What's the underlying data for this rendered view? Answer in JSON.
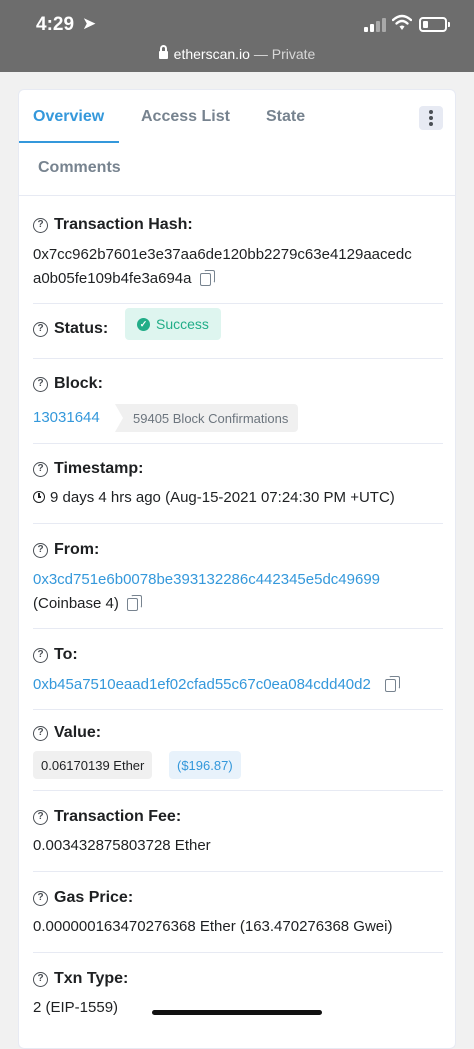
{
  "status_bar": {
    "time": "4:29",
    "domain": "etherscan.io",
    "separator": " — ",
    "private_label": "Private"
  },
  "tabs": [
    {
      "label": "Overview",
      "active": true
    },
    {
      "label": "Access List"
    },
    {
      "label": "State"
    },
    {
      "label": "Comments"
    }
  ],
  "more_icon": "vertical-dots-icon",
  "fields": {
    "tx_hash": {
      "label": "Transaction Hash:",
      "line1": "0x7cc962b7601e3e37aa6de120bb2279c63e4129aacedc",
      "line2": "a0b05fe109b4fe3a694a"
    },
    "status": {
      "label": "Status:",
      "value": "Success"
    },
    "block": {
      "label": "Block:",
      "number": "13031644",
      "confirmations": "59405 Block Confirmations"
    },
    "timestamp": {
      "label": "Timestamp:",
      "value": "9 days 4 hrs ago (Aug-15-2021 07:24:30 PM +UTC)"
    },
    "from": {
      "label": "From:",
      "address": "0x3cd751e6b0078be393132286c442345e5dc49699",
      "name": "(Coinbase 4)"
    },
    "to": {
      "label": "To:",
      "address": "0xb45a7510eaad1ef02cfad55c67c0ea084cdd40d2"
    },
    "value": {
      "label": "Value:",
      "ether": "0.06170139 Ether",
      "usd": "($196.87)"
    },
    "fee": {
      "label": "Transaction Fee:",
      "value": "0.003432875803728 Ether"
    },
    "gas_price": {
      "label": "Gas Price:",
      "value": "0.000000163470276368 Ether (163.470276368 Gwei)"
    },
    "txn_type": {
      "label": "Txn Type:",
      "value": "2 (EIP-1559)"
    }
  },
  "colors": {
    "accent": "#3498db",
    "success": "#22ad88",
    "status_bar": "#6d6d6d"
  }
}
